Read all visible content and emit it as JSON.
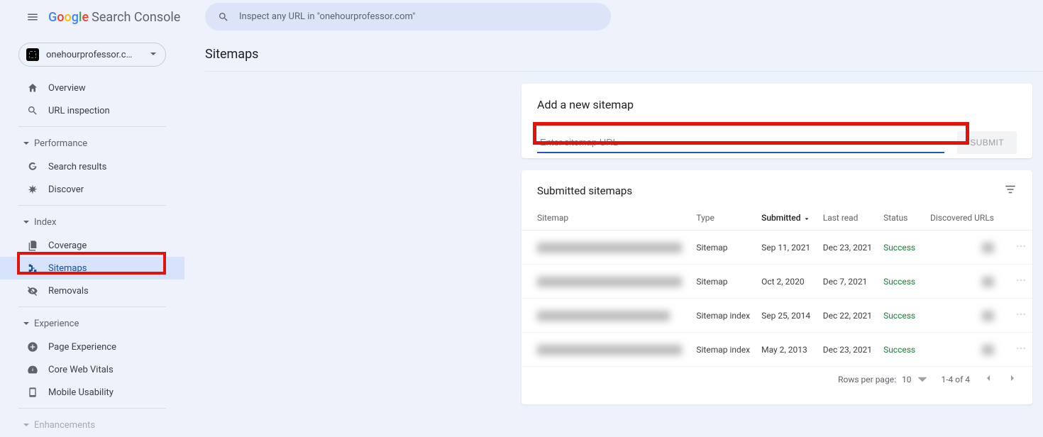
{
  "header": {
    "product_name": "Search Console",
    "google_letters": [
      "G",
      "o",
      "o",
      "g",
      "l",
      "e"
    ],
    "search_placeholder": "Inspect any URL in \"onehourprofessor.com\""
  },
  "property": {
    "name": "onehourprofessor.c…"
  },
  "nav": {
    "overview": "Overview",
    "url_inspection": "URL inspection",
    "section_performance": "Performance",
    "search_results": "Search results",
    "discover": "Discover",
    "section_index": "Index",
    "coverage": "Coverage",
    "sitemaps": "Sitemaps",
    "removals": "Removals",
    "section_experience": "Experience",
    "page_experience": "Page Experience",
    "core_web_vitals": "Core Web Vitals",
    "mobile_usability": "Mobile Usability",
    "section_enhancements": "Enhancements"
  },
  "page": {
    "title": "Sitemaps"
  },
  "add_card": {
    "heading": "Add a new sitemap",
    "placeholder": "Enter sitemap URL",
    "submit": "SUBMIT"
  },
  "list_card": {
    "heading": "Submitted sitemaps",
    "columns": {
      "sitemap": "Sitemap",
      "type": "Type",
      "submitted": "Submitted",
      "last_read": "Last read",
      "status": "Status",
      "discovered": "Discovered URLs"
    },
    "rows": [
      {
        "sitemap": "████████████████████████",
        "type": "Sitemap",
        "submitted": "Sep 11, 2021",
        "last_read": "Dec 23, 2021",
        "status": "Success",
        "discovered": "██"
      },
      {
        "sitemap": "████████████████████████",
        "type": "Sitemap",
        "submitted": "Oct 2, 2020",
        "last_read": "Dec 7, 2021",
        "status": "Success",
        "discovered": "██"
      },
      {
        "sitemap": "██████████████████████",
        "type": "Sitemap index",
        "submitted": "Sep 25, 2014",
        "last_read": "Dec 22, 2021",
        "status": "Success",
        "discovered": "██"
      },
      {
        "sitemap": "████████████████████████",
        "type": "Sitemap index",
        "submitted": "May 2, 2013",
        "last_read": "Dec 23, 2021",
        "status": "Success",
        "discovered": "██"
      }
    ],
    "pager": {
      "rows_per_page_label": "Rows per page:",
      "rows_per_page_value": "10",
      "range": "1-4 of 4"
    }
  }
}
